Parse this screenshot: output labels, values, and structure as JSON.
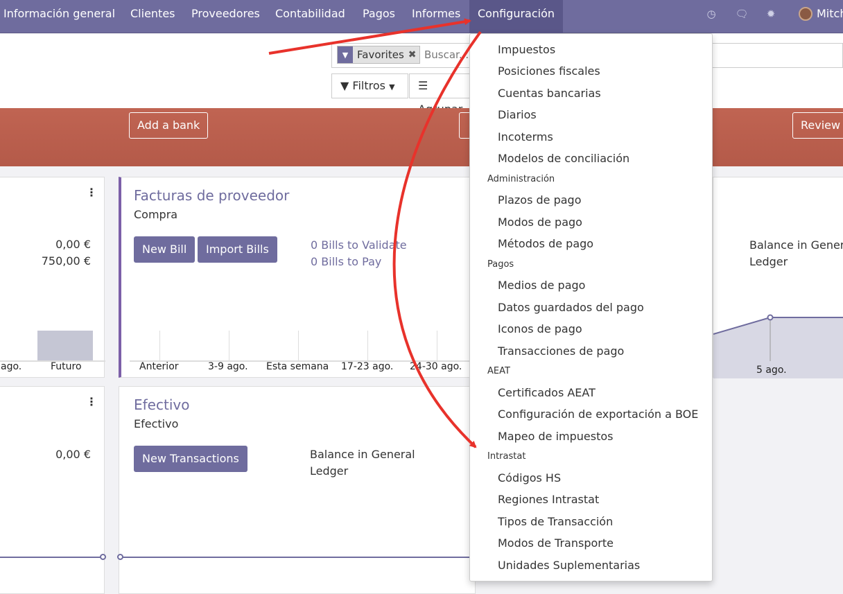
{
  "nav": {
    "items": [
      "Información general",
      "Clientes",
      "Proveedores",
      "Contabilidad",
      "Pagos",
      "Informes",
      "Configuración"
    ],
    "user": "Mitch",
    "accent": "#6f6c9e"
  },
  "search": {
    "facet_label": "Favorites",
    "placeholder": "Buscar..."
  },
  "filters": {
    "filters_label": "Filtros",
    "groupby_label": "Agrupar"
  },
  "banner": {
    "add_bank": "Add a bank",
    "review": "Review",
    "color": "#b45a49"
  },
  "cards": {
    "left_top": {
      "amount1": "0,00 €",
      "amount2": "750,00 €",
      "tick1": "ago.",
      "tick2": "Futuro",
      "future_bar": 1
    },
    "purchases": {
      "title": "Facturas de proveedor",
      "subtitle": "Compra",
      "new_bill": "New Bill",
      "import_bills": "Import Bills",
      "validate_link": "0 Bills to Validate",
      "pay_link": "0 Bills to Pay",
      "ticks": [
        "Anterior",
        "3-9 ago.",
        "Esta semana",
        "17-23 ago.",
        "24-30 ago."
      ]
    },
    "right_top": {
      "balance_line1": "Balance in General",
      "balance_line2": "Ledger",
      "tick": "5 ago."
    },
    "left_bottom": {
      "amount": "0,00 €"
    },
    "cash": {
      "title": "Efectivo",
      "subtitle": "Efectivo",
      "new_transactions": "New Transactions",
      "balance_line1": "Balance in General",
      "balance_line2": "Ledger"
    }
  },
  "dropdown": {
    "group1": [
      "Impuestos",
      "Posiciones fiscales",
      "Cuentas bancarias",
      "Diarios",
      "Incoterms",
      "Modelos de conciliación"
    ],
    "header2": "Administración",
    "group2": [
      "Plazos de pago",
      "Modos de pago",
      "Métodos de pago"
    ],
    "header3": "Pagos",
    "group3": [
      "Medios de pago",
      "Datos guardados del pago",
      "Iconos de pago",
      "Transacciones de pago"
    ],
    "header4": "AEAT",
    "group4": [
      "Certificados AEAT",
      "Configuración de exportación a BOE",
      "Mapeo de impuestos"
    ],
    "header5": "Intrastat",
    "group5": [
      "Códigos HS",
      "Regiones Intrastat",
      "Tipos de Transacción",
      "Modos de Transporte",
      "Unidades Suplementarias"
    ]
  },
  "icons": [
    "clock-icon",
    "chat-icon",
    "bug-icon",
    "filter-icon",
    "close-icon",
    "list-icon",
    "caret-down-icon",
    "kebab-icon"
  ],
  "annotation_color": "#e8322b"
}
